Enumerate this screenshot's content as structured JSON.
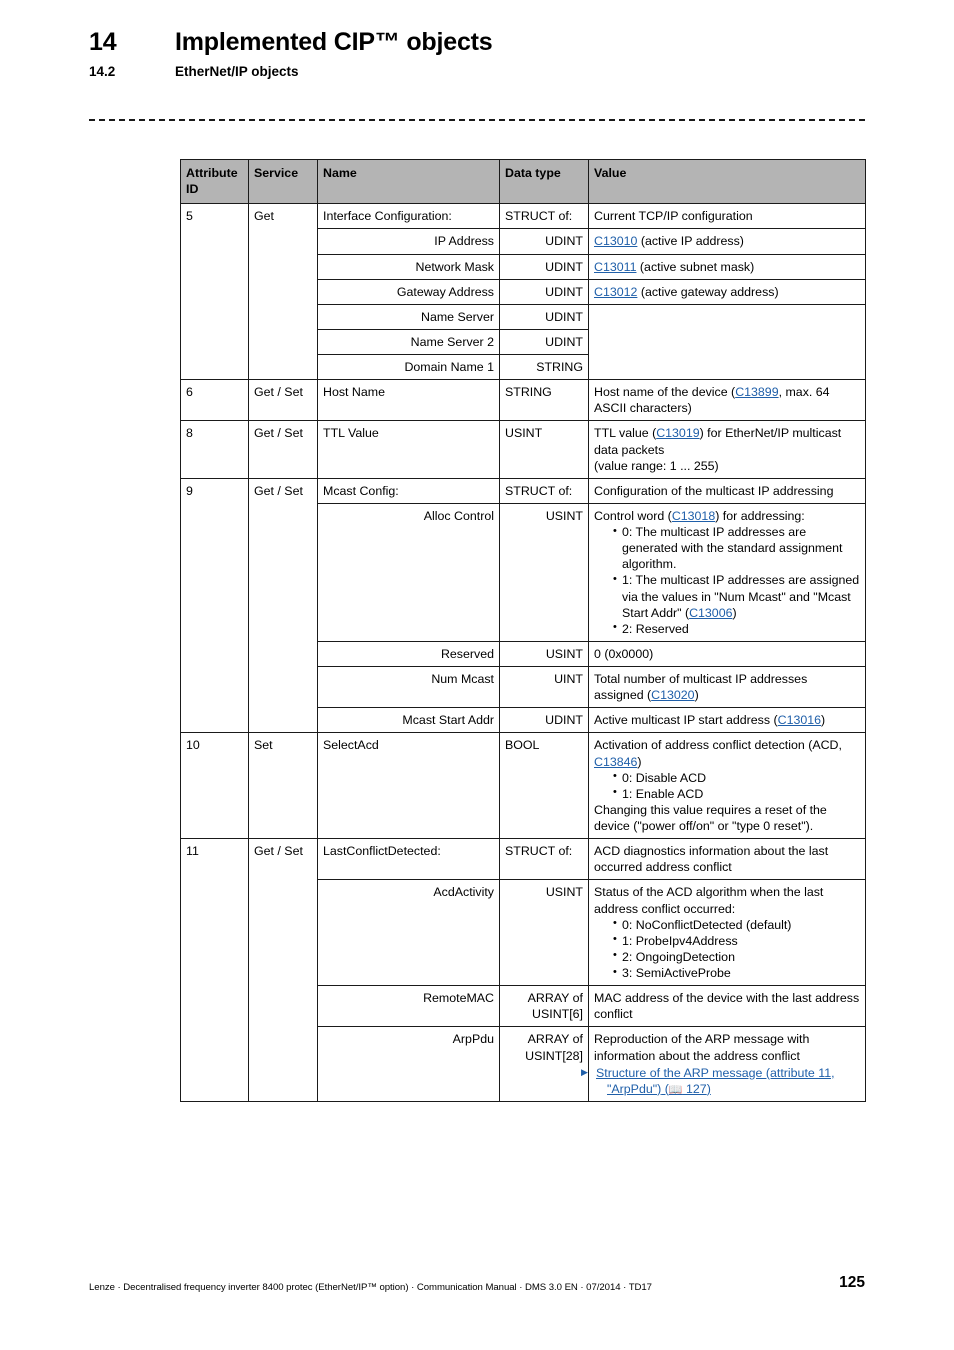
{
  "header": {
    "chapter_number": "14",
    "chapter_title": "Implemented CIP™ objects",
    "section_number": "14.2",
    "section_title": "EtherNet/IP objects"
  },
  "table": {
    "columns": [
      "Attribute ID",
      "Service",
      "Name",
      "Data type",
      "Value"
    ],
    "column_headers": {
      "attribute_id": "Attribute ID",
      "service": "Service",
      "name": "Name",
      "data_type": "Data type",
      "value": "Value"
    },
    "rows": [
      {
        "attribute_id": "5",
        "service": "Get",
        "name": "Interface Configuration:",
        "data_type": "STRUCT of:",
        "value": "Current TCP/IP configuration"
      },
      {
        "name": "IP Address",
        "data_type": "UDINT",
        "value_link": "C13010",
        "value_rest": " (active IP address)"
      },
      {
        "name": "Network Mask",
        "data_type": "UDINT",
        "value_link": "C13011",
        "value_rest": " (active subnet mask)"
      },
      {
        "name": "Gateway Address",
        "data_type": "UDINT",
        "value_link": "C13012",
        "value_rest": " (active gateway address)"
      },
      {
        "name": "Name Server",
        "data_type": "UDINT",
        "value": ""
      },
      {
        "name": "Name Server 2",
        "data_type": "UDINT",
        "value": ""
      },
      {
        "name": "Domain Name 1",
        "data_type": "STRING",
        "value": ""
      },
      {
        "attribute_id": "6",
        "service": "Get / Set",
        "name": "Host Name",
        "data_type": "STRING",
        "value_pre": "Host name of the device (",
        "value_link": "C13899",
        "value_rest": ", max. 64 ASCII characters)"
      },
      {
        "attribute_id": "8",
        "service": "Get / Set",
        "name": "TTL Value",
        "data_type": "USINT",
        "value_pre": "TTL value (",
        "value_link": "C13019",
        "value_rest": ") for EtherNet/IP multicast data packets",
        "value_line2": "(value range: 1 ... 255)"
      },
      {
        "attribute_id": "9",
        "service": "Get / Set",
        "name": "Mcast Config:",
        "data_type": "STRUCT of:",
        "value": "Configuration of the multicast IP addressing"
      },
      {
        "name": "Alloc Control",
        "data_type": "USINT",
        "value_pre": "Control word (",
        "value_link": "C13018",
        "value_rest": ") for addressing:",
        "bullets": [
          "0: The multicast IP addresses are generated with the standard assignment algorithm.",
          "1: The multicast IP addresses are assigned via the values in \"Num Mcast\" and \"Mcast Start Addr\" (C13006)",
          "2: Reserved"
        ],
        "bullet_link": "C13006"
      },
      {
        "name": "Reserved",
        "data_type": "USINT",
        "value": "0 (0x0000)"
      },
      {
        "name": "Num Mcast",
        "data_type": "UINT",
        "value_pre": "Total number of multicast IP addresses assigned (",
        "value_link": "C13020",
        "value_rest": ")"
      },
      {
        "name": "Mcast Start Addr",
        "data_type": "UDINT",
        "value_pre": "Active multicast IP start address (",
        "value_link": "C13016",
        "value_rest": ")"
      },
      {
        "attribute_id": "10",
        "service": "Set",
        "name": "SelectAcd",
        "data_type": "BOOL",
        "value_pre": "Activation of address conflict detection (ACD, ",
        "value_link": "C13846",
        "value_rest": ")",
        "bullets": [
          "0: Disable ACD",
          "1: Enable ACD"
        ],
        "value_after": "Changing this value requires a reset of the device (\"power off/on\" or \"type 0 reset\")."
      },
      {
        "attribute_id": "11",
        "service": "Get / Set",
        "name": "LastConflictDetected:",
        "data_type": "STRUCT of:",
        "value": "ACD diagnostics information about the last occurred address conflict"
      },
      {
        "name": "AcdActivity",
        "data_type": "USINT",
        "value": "Status of the ACD algorithm when the last address conflict occurred:",
        "bullets": [
          "0: NoConflictDetected (default)",
          "1: ProbeIpv4Address",
          "2: OngoingDetection",
          "3: SemiActiveProbe"
        ]
      },
      {
        "name": "RemoteMAC",
        "data_type": "ARRAY of USINT[6]",
        "value": "MAC address of the device with the last address conflict"
      },
      {
        "name": "ArpPdu",
        "data_type": "ARRAY of USINT[28]",
        "value": "Reproduction of the ARP message with information about the address conflict",
        "xref_text": "Structure of the ARP message (attribute 11, \"ArpPdu\")",
        "xref_page": "127"
      }
    ]
  },
  "footer": {
    "text": "Lenze · Decentralised frequency inverter 8400 protec (EtherNet/IP™ option) · Communication Manual · DMS 3.0 EN · 07/2014 · TD17",
    "page_number": "125"
  },
  "colors": {
    "header_fill": "#b4b4b4",
    "link": "#1f5fa9",
    "border": "#1a1a1a"
  }
}
